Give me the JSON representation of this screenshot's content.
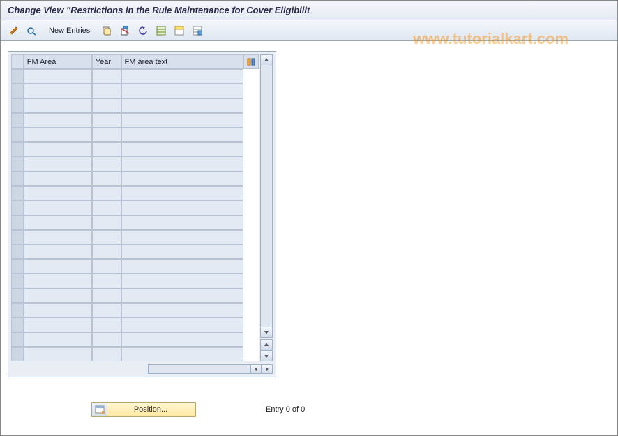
{
  "title": "Change View \"Restrictions in the Rule Maintenance for Cover Eligibilit",
  "watermark": "www.tutorialkart.com",
  "toolbar": {
    "new_entries_label": "New Entries"
  },
  "grid": {
    "columns": {
      "fm_area": "FM Area",
      "year": "Year",
      "fm_area_text": "FM area text"
    },
    "rows": [
      {
        "fm_area": "",
        "year": "",
        "fm_area_text": ""
      },
      {
        "fm_area": "",
        "year": "",
        "fm_area_text": ""
      },
      {
        "fm_area": "",
        "year": "",
        "fm_area_text": ""
      },
      {
        "fm_area": "",
        "year": "",
        "fm_area_text": ""
      },
      {
        "fm_area": "",
        "year": "",
        "fm_area_text": ""
      },
      {
        "fm_area": "",
        "year": "",
        "fm_area_text": ""
      },
      {
        "fm_area": "",
        "year": "",
        "fm_area_text": ""
      },
      {
        "fm_area": "",
        "year": "",
        "fm_area_text": ""
      },
      {
        "fm_area": "",
        "year": "",
        "fm_area_text": ""
      },
      {
        "fm_area": "",
        "year": "",
        "fm_area_text": ""
      },
      {
        "fm_area": "",
        "year": "",
        "fm_area_text": ""
      },
      {
        "fm_area": "",
        "year": "",
        "fm_area_text": ""
      },
      {
        "fm_area": "",
        "year": "",
        "fm_area_text": ""
      },
      {
        "fm_area": "",
        "year": "",
        "fm_area_text": ""
      },
      {
        "fm_area": "",
        "year": "",
        "fm_area_text": ""
      },
      {
        "fm_area": "",
        "year": "",
        "fm_area_text": ""
      },
      {
        "fm_area": "",
        "year": "",
        "fm_area_text": ""
      },
      {
        "fm_area": "",
        "year": "",
        "fm_area_text": ""
      },
      {
        "fm_area": "",
        "year": "",
        "fm_area_text": ""
      },
      {
        "fm_area": "",
        "year": "",
        "fm_area_text": ""
      }
    ]
  },
  "footer": {
    "position_label": "Position...",
    "entry_text": "Entry 0 of 0"
  }
}
